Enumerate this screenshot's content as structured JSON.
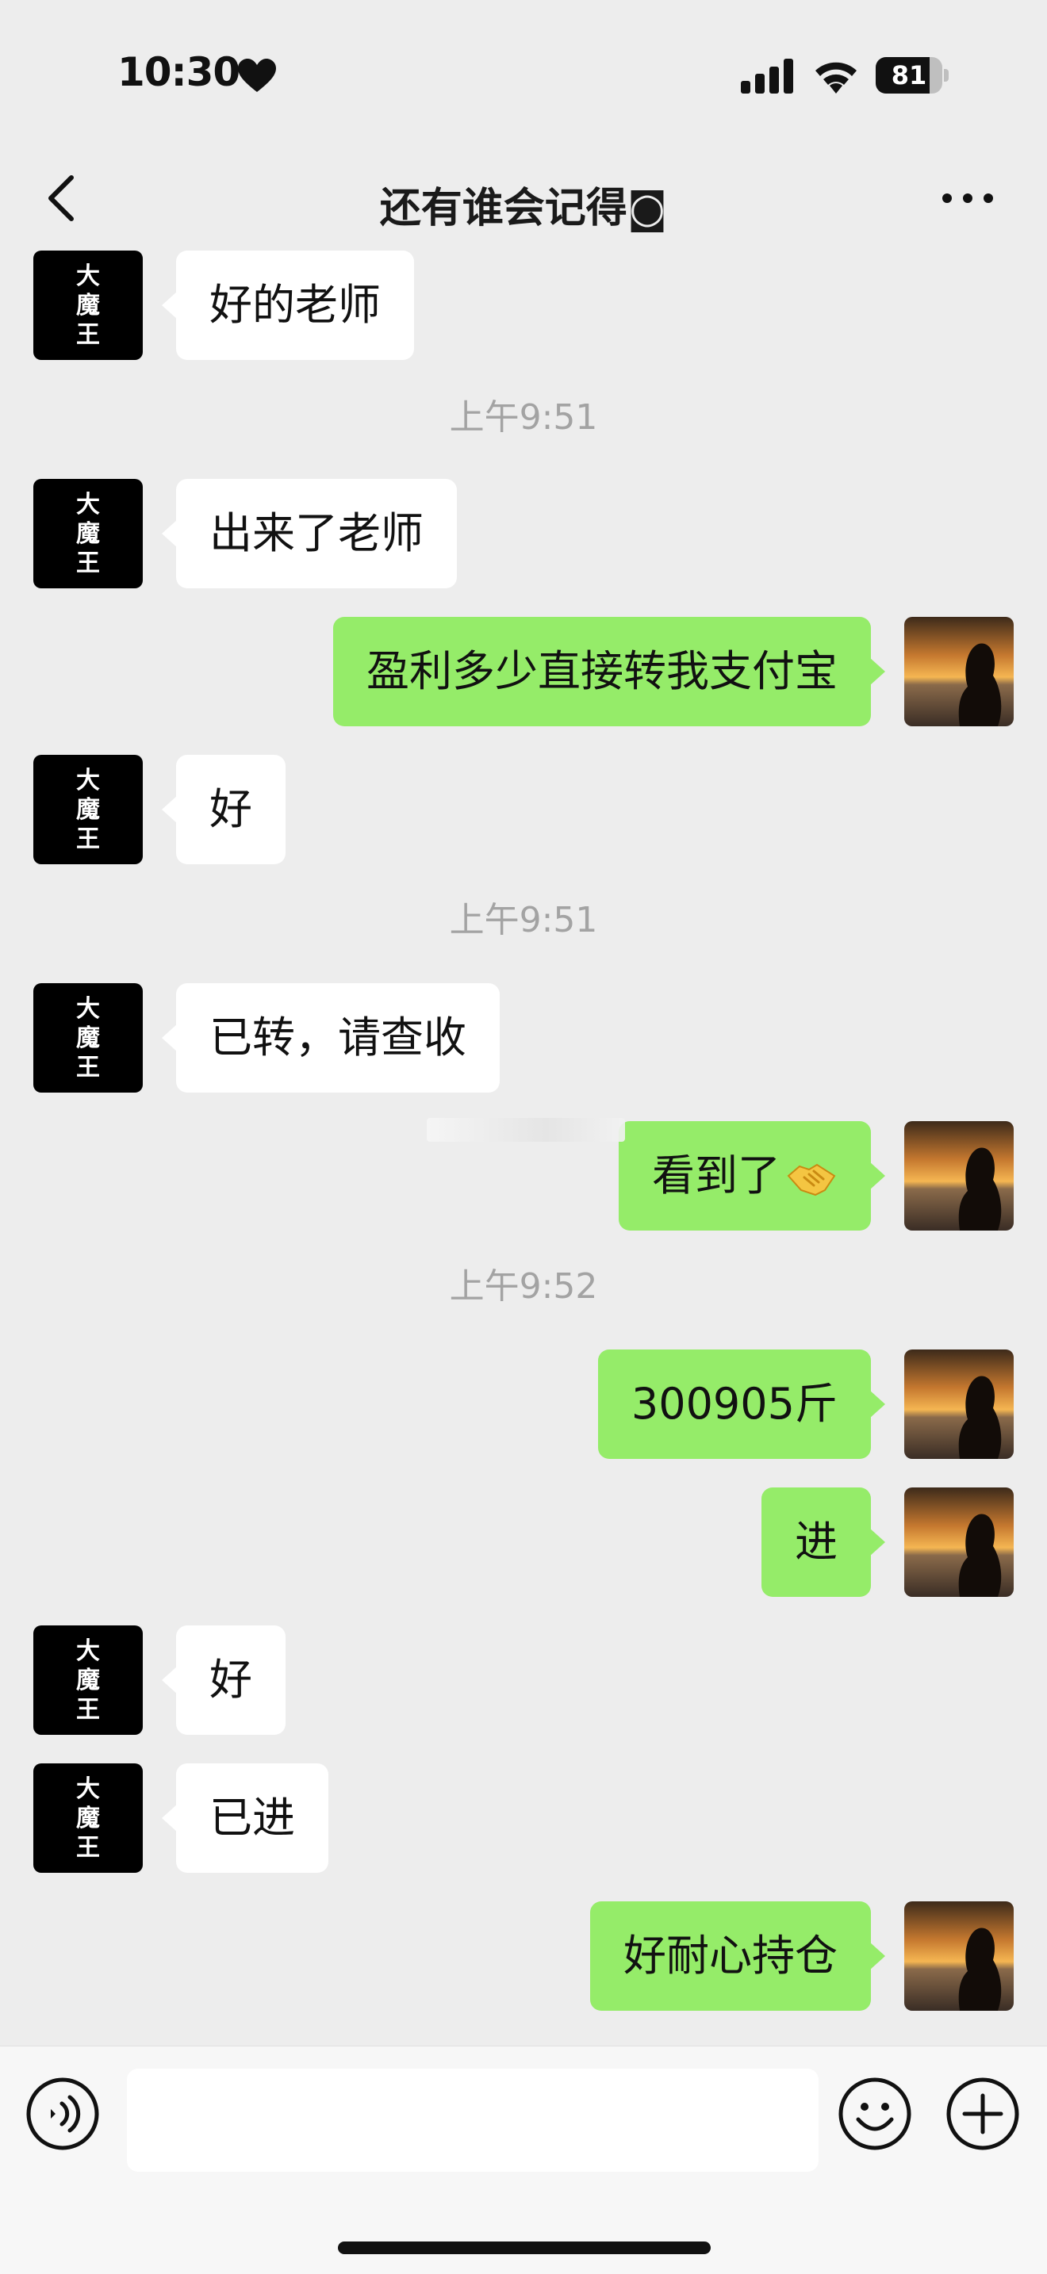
{
  "status_bar": {
    "time": "10:30",
    "battery": "81",
    "battery_level": 0.81
  },
  "nav": {
    "title": "还有谁会记得◙"
  },
  "left_avatar_text": [
    "大",
    "魔",
    "王"
  ],
  "messages": [
    {
      "kind": "in",
      "text": "好的老师"
    },
    {
      "kind": "time",
      "text": "上午9:51"
    },
    {
      "kind": "in",
      "text": "出来了老师"
    },
    {
      "kind": "out",
      "text": "盈利多少直接转我支付宝"
    },
    {
      "kind": "in",
      "text": "好"
    },
    {
      "kind": "time",
      "text": "上午9:51"
    },
    {
      "kind": "in",
      "text": "已转，请查收"
    },
    {
      "kind": "out",
      "text": "看到了",
      "emoji": "handshake-icon"
    },
    {
      "kind": "time",
      "text": "上午9:52"
    },
    {
      "kind": "out",
      "text": "300905斤"
    },
    {
      "kind": "out",
      "text": "进"
    },
    {
      "kind": "in",
      "text": "好"
    },
    {
      "kind": "in",
      "text": "已进"
    },
    {
      "kind": "out",
      "text": "好耐心持仓"
    }
  ],
  "colors": {
    "outgoing_bubble": "#95ec69",
    "incoming_bubble": "#ffffff",
    "background": "#ededed"
  },
  "icons": {
    "voice": "voice-icon",
    "emoji": "smiley-icon",
    "plus": "plus-icon",
    "back": "chevron-left-icon",
    "more": "more-dots-icon"
  },
  "input": {
    "value": ""
  }
}
